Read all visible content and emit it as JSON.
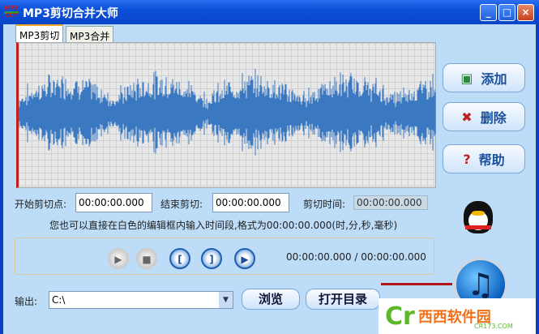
{
  "window": {
    "title": "MP3剪切合并大师",
    "icon_text": "MP3 CUT",
    "minimize": "_",
    "maximize": "□",
    "close": "×"
  },
  "tabs": [
    {
      "label": "MP3剪切"
    },
    {
      "label": "MP3合并"
    }
  ],
  "side_buttons": {
    "add": "添加",
    "delete": "删除",
    "help": "帮助"
  },
  "fields": {
    "start_label": "开始剪切点:",
    "start_value": "00:00:00.000",
    "end_label": "结束剪切:",
    "end_value": "00:00:00.000",
    "duration_label": "剪切时间:",
    "duration_value": "00:00:00.000"
  },
  "hint": "您也可以直接在白色的编辑框内输入时间段,格式为00:00:00.000(时,分,秒,毫秒)",
  "playback": {
    "time": "00:00:00.000 / 00:00:00.000",
    "mark_start": "[",
    "mark_end": "]"
  },
  "output": {
    "label": "输出:",
    "value": "C:\\",
    "browse": "浏览",
    "open_dir": "打开目录"
  },
  "watermark": {
    "brand": "西西软件园",
    "site": "CR173.COM"
  }
}
